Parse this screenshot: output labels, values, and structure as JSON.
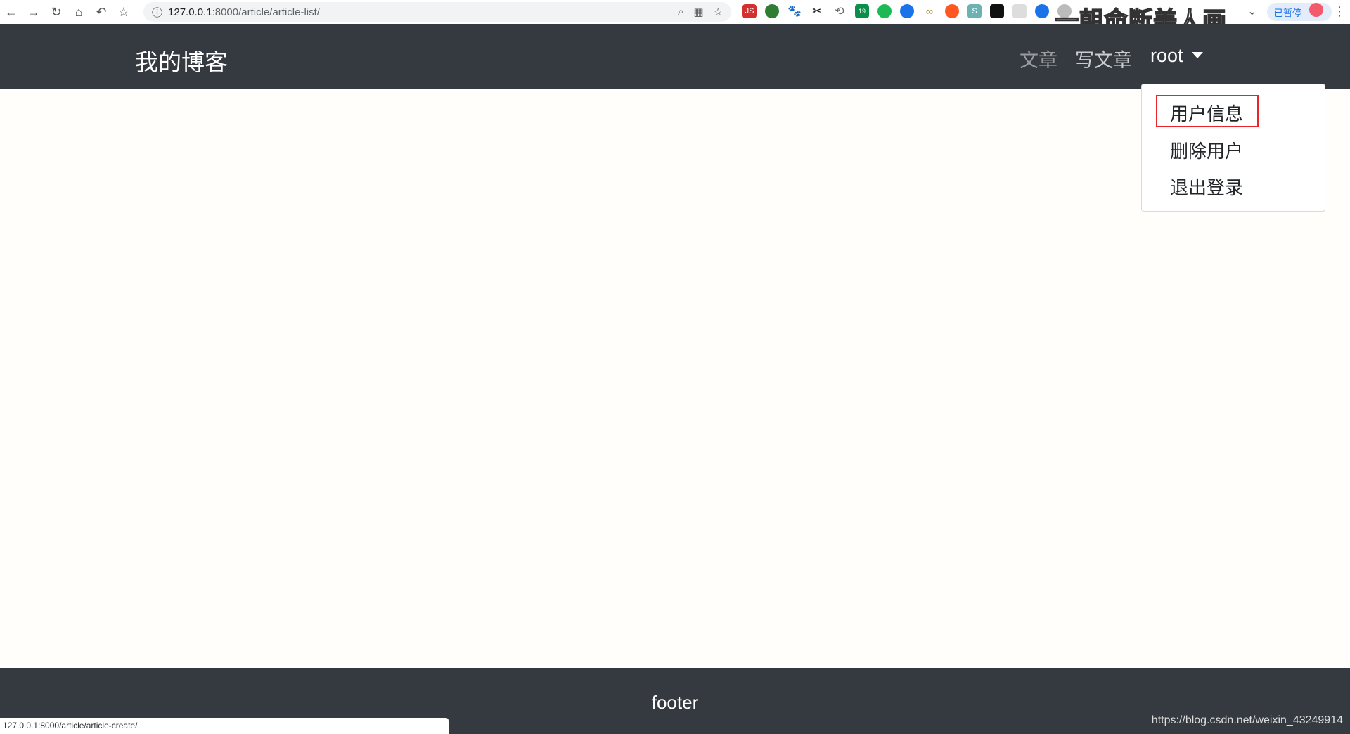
{
  "browser": {
    "url_host": "127.0.0.1",
    "url_rest": ":8000/article/article-list/",
    "paused_label": "已暂停",
    "extension_badge": "19",
    "watermark_title": "一朝命断美人画"
  },
  "navbar": {
    "brand": "我的博客",
    "links": [
      {
        "label": "文章"
      },
      {
        "label": "写文章"
      }
    ],
    "user": "root"
  },
  "dropdown": {
    "items": [
      {
        "label": "用户信息"
      },
      {
        "label": "删除用户"
      },
      {
        "label": "退出登录"
      }
    ],
    "highlight_color": "#e8262a"
  },
  "footer": {
    "text": "footer"
  },
  "status_bar": {
    "url": "127.0.0.1:8000/article/article-create/"
  },
  "credit": "https://blog.csdn.net/weixin_43249914",
  "colors": {
    "navbar": "#343a40",
    "background": "#fffefb"
  }
}
